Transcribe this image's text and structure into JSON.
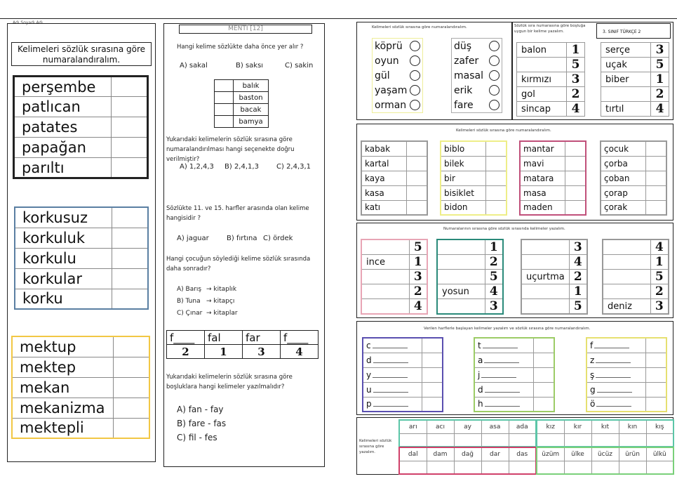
{
  "page": {
    "header_small": "Adı Soyadı Adı",
    "left": {
      "instruction": "Kelimeleri sözlük sırasına göre numaralandıralım.",
      "group1": [
        "perşembe",
        "patlıcan",
        "patates",
        "papağan",
        "parıltı"
      ],
      "group2": [
        "korkusuz",
        "korkuluk",
        "korkulu",
        "korkular",
        "korku"
      ],
      "group3": [
        "mektup",
        "mektep",
        "mekan",
        "mekanizma",
        "mektepli"
      ],
      "group_colors": [
        "#222222",
        "#5a7fa2",
        "#f2c744"
      ]
    },
    "middle": {
      "title": "MENTİ [12]",
      "q1": "Hangi kelime sözlükte daha önce yer alır ?",
      "q1_options": [
        "A) sakal",
        "B) saksı",
        "C) sakin"
      ],
      "box_words": [
        "balık",
        "baston",
        "bacak",
        "bamya"
      ],
      "q2": "Yukarıdaki kelimelerin sözlük sırasına göre numaralandırılması hangi seçenekte doğru verilmiştir?",
      "q2_options": [
        "A) 1,2,4,3",
        "B) 2,4,1,3",
        "C) 2,4,3,1"
      ],
      "q3": "Sözlükte 11. ve 15. harfler arasında olan kelime hangisidir ?",
      "q3_options": [
        "A) jaguar",
        "B) fırtına",
        "C) ördek"
      ],
      "q4": "Hangi çocuğun söylediği kelime sözlük sırasında daha sonradır?",
      "q4_options": [
        {
          "name": "A) Barış",
          "word": "kitaplık"
        },
        {
          "name": "B) Tuna",
          "word": "kitapçı"
        },
        {
          "name": "C) Çınar",
          "word": "kitaplar"
        }
      ],
      "arrow": "→",
      "fill_table": {
        "words": [
          "f____",
          "fal",
          "far",
          "f____"
        ],
        "numbers": [
          "2",
          "1",
          "3",
          "4"
        ]
      },
      "q5": "Yukarıdaki kelimelerin sözlük sırasına göre boşluklara hangi kelimeler yazılmalıdır?",
      "q5_options": [
        "A) fan - fay",
        "B) fare - fas",
        "C) fil - fes"
      ]
    },
    "right": {
      "sec1_title": "Kelimeleri sözlük sırasına göre numaralandıralım.",
      "circle_list1": [
        "köprü",
        "oyun",
        "gül",
        "yaşam",
        "orman"
      ],
      "circle_list2": [
        "düş",
        "zafer",
        "masal",
        "erik",
        "fare"
      ],
      "sec1b_title": "Sözlük sıra numarasına göre boşluğa uygun bir kelime yazalım.",
      "grade_label": "3. SINIF TÜRKÇE 2",
      "fill1": [
        {
          "word": "balon",
          "num": "1"
        },
        {
          "word": "",
          "num": "5"
        },
        {
          "word": "kırmızı",
          "num": "3"
        },
        {
          "word": "gol",
          "num": "2"
        },
        {
          "word": "sincap",
          "num": "4"
        }
      ],
      "fill2": [
        {
          "word": "serçe",
          "num": "3"
        },
        {
          "word": "uçak",
          "num": "5"
        },
        {
          "word": "biber",
          "num": "1"
        },
        {
          "word": "",
          "num": "2"
        },
        {
          "word": "tırtıl",
          "num": "4"
        }
      ],
      "sec2_title": "Kelimeleri sözlük sırasına göre numaralandıralım.",
      "sec2_lists": [
        {
          "color": "#999999",
          "words": [
            "kabak",
            "kartal",
            "kaya",
            "kasa",
            "katı"
          ]
        },
        {
          "color": "#eeee88",
          "words": [
            "biblo",
            "bilek",
            "bir",
            "bisiklet",
            "bidon"
          ]
        },
        {
          "color": "#c0507a",
          "words": [
            "mantar",
            "mavi",
            "matara",
            "masa",
            "maden"
          ]
        },
        {
          "color": "#999999",
          "words": [
            "çocuk",
            "çorba",
            "çoban",
            "çorap",
            "çorak"
          ]
        }
      ],
      "sec3_title": "Numaralarının sırasına göre sözlük sırasında kelimeler yazalım.",
      "sec3_lists": [
        {
          "color": "#e8a5b5",
          "rows": [
            {
              "w": "",
              "n": "5"
            },
            {
              "w": "ince",
              "n": "1"
            },
            {
              "w": "",
              "n": "3"
            },
            {
              "w": "",
              "n": "2"
            },
            {
              "w": "",
              "n": "4"
            }
          ]
        },
        {
          "color": "#2a8a7a",
          "rows": [
            {
              "w": "",
              "n": "1"
            },
            {
              "w": "",
              "n": "2"
            },
            {
              "w": "",
              "n": "5"
            },
            {
              "w": "yosun",
              "n": "4"
            },
            {
              "w": "",
              "n": "3"
            }
          ]
        },
        {
          "color": "#999999",
          "rows": [
            {
              "w": "",
              "n": "3"
            },
            {
              "w": "",
              "n": "4"
            },
            {
              "w": "uçurtma",
              "n": "2"
            },
            {
              "w": "",
              "n": "1"
            },
            {
              "w": "",
              "n": "5"
            }
          ]
        },
        {
          "color": "#999999",
          "rows": [
            {
              "w": "",
              "n": "4"
            },
            {
              "w": "",
              "n": "1"
            },
            {
              "w": "",
              "n": "5"
            },
            {
              "w": "",
              "n": "2"
            },
            {
              "w": "deniz",
              "n": "3"
            }
          ]
        }
      ],
      "sec4_title": "Verilen harflerle başlayan kelimeler yazalım ve sözlük sırasına göre numaralandıralım.",
      "sec4_lists": [
        {
          "color": "#5a4fb0",
          "letters": [
            "c",
            "d",
            "y",
            "u",
            "p"
          ]
        },
        {
          "color": "#9ccc66",
          "letters": [
            "t",
            "a",
            "j",
            "d",
            "h"
          ]
        },
        {
          "color": "#e6e070",
          "letters": [
            "f",
            "z",
            "ş",
            "g",
            "ö"
          ]
        }
      ],
      "sec5_title": "Kelimeleri sözlük sırasına göre yazalım.",
      "syl_row1a": [
        "arı",
        "acı",
        "ay",
        "asa",
        "ada"
      ],
      "syl_row1b": [
        "kız",
        "kır",
        "kıt",
        "kın",
        "kış"
      ],
      "syl_row2a": [
        "dal",
        "dam",
        "dağ",
        "dar",
        "das"
      ],
      "syl_row2b": [
        "üzüm",
        "ülke",
        "ücüz",
        "ürün",
        "ülkü"
      ]
    }
  }
}
